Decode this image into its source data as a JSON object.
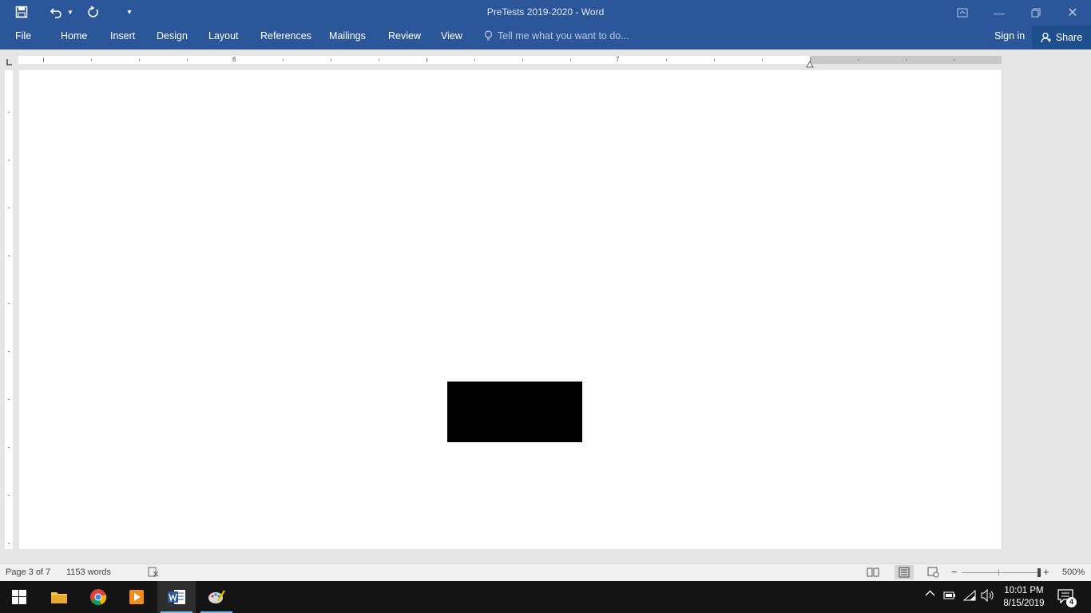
{
  "window": {
    "title": "PreTests 2019-2020 - Word"
  },
  "ribbon": {
    "tabs": [
      "File",
      "Home",
      "Insert",
      "Design",
      "Layout",
      "References",
      "Mailings",
      "Review",
      "View"
    ],
    "tell_me": "Tell me what you want to do...",
    "sign_in": "Sign in",
    "share": "Share"
  },
  "ruler": {
    "labels": [
      "6",
      "7"
    ]
  },
  "status": {
    "page": "Page 3 of 7",
    "words": "1153 words",
    "zoom": "500%"
  },
  "taskbar": {
    "time": "10:01 PM",
    "date": "8/15/2019",
    "notification_count": "4"
  },
  "colors": {
    "title_bar": "#2b579a",
    "taskbar": "#141414"
  }
}
